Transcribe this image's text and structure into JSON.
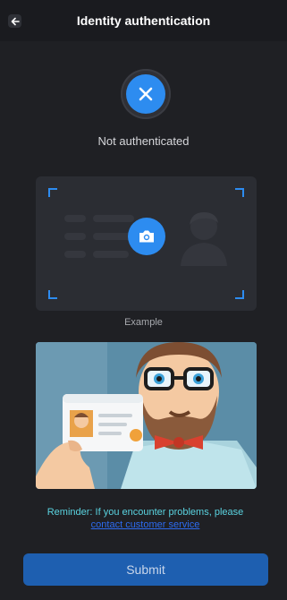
{
  "header": {
    "title": "Identity authentication",
    "back_icon": "arrow-left-icon"
  },
  "status": {
    "text": "Not authenticated",
    "icon": "close-icon",
    "color": "#2d8cf0"
  },
  "example": {
    "label": "Example",
    "camera_icon": "camera-icon"
  },
  "illustration": {
    "description_icon": "person-holding-id-card-illustration"
  },
  "reminder": {
    "text": "Reminder: If you encounter problems, please",
    "link": "contact customer service"
  },
  "submit": {
    "label": "Submit"
  },
  "colors": {
    "accent": "#2d8cf0",
    "background": "#1f2024",
    "reminder_text": "#5ad3e0",
    "button": "#1e5fb0"
  }
}
